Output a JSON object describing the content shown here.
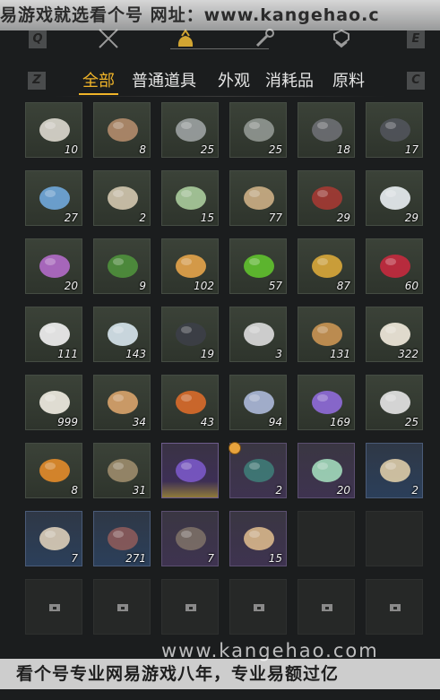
{
  "watermark": {
    "top_text": "易游戏就选看个号   网址：www.kangehao.c",
    "mid_text": "www.kangehao.com",
    "bottom_text": "看个号专业网易游戏八年，专业易额过亿"
  },
  "keys": {
    "left_top": "Q",
    "right_top": "E",
    "left_tab": "Z",
    "right_tab": "C"
  },
  "top_icons": [
    "crossed-swords-icon",
    "bag-icon",
    "wrench-icon",
    "armor-icon"
  ],
  "tabs": [
    {
      "label": "全部",
      "active": true
    },
    {
      "label": "普通道具",
      "active": false
    },
    {
      "label": "外观",
      "active": false
    },
    {
      "label": "消耗品",
      "active": false
    },
    {
      "label": "原料",
      "active": false
    }
  ],
  "items": [
    {
      "name": "coral",
      "count": "10"
    },
    {
      "name": "pufferfish",
      "count": "8"
    },
    {
      "name": "fish",
      "count": "25"
    },
    {
      "name": "catfish",
      "count": "25"
    },
    {
      "name": "iron-ore",
      "count": "18"
    },
    {
      "name": "dark-ore",
      "count": "17"
    },
    {
      "name": "blue-crystal",
      "count": "27"
    },
    {
      "name": "bone-spine",
      "count": "2"
    },
    {
      "name": "green-egg",
      "count": "15"
    },
    {
      "name": "rice-sacks",
      "count": "77"
    },
    {
      "name": "red-berry-herb",
      "count": "29"
    },
    {
      "name": "white-flower",
      "count": "29"
    },
    {
      "name": "purple-flower",
      "count": "20"
    },
    {
      "name": "green-herb",
      "count": "9"
    },
    {
      "name": "sparkler",
      "count": "102"
    },
    {
      "name": "jade-orb",
      "count": "57"
    },
    {
      "name": "gold-ore",
      "count": "87"
    },
    {
      "name": "red-crystal",
      "count": "60"
    },
    {
      "name": "white-lily",
      "count": "111"
    },
    {
      "name": "ice-block",
      "count": "143"
    },
    {
      "name": "dark-feather",
      "count": "19"
    },
    {
      "name": "white-fur",
      "count": "3"
    },
    {
      "name": "wood-bundle",
      "count": "131"
    },
    {
      "name": "rice-bowl",
      "count": "322"
    },
    {
      "name": "milk-bowl",
      "count": "999"
    },
    {
      "name": "tofu-cubes",
      "count": "34"
    },
    {
      "name": "roast-meat",
      "count": "43"
    },
    {
      "name": "blue-spider-lily",
      "count": "94"
    },
    {
      "name": "lavender",
      "count": "169"
    },
    {
      "name": "white-peony",
      "count": "25"
    },
    {
      "name": "orange-fruit-herb",
      "count": "8"
    },
    {
      "name": "root-herb",
      "count": "31"
    },
    {
      "name": "amethyst",
      "count": ""
    },
    {
      "name": "gift-box-dark",
      "count": "2"
    },
    {
      "name": "gift-box-green",
      "count": "20"
    },
    {
      "name": "scroll",
      "count": "2"
    },
    {
      "name": "clay-jar",
      "count": "7"
    },
    {
      "name": "book-chest",
      "count": "271"
    },
    {
      "name": "horn-dark",
      "count": "7"
    },
    {
      "name": "horn-light",
      "count": "15"
    }
  ],
  "colors": {
    "accent": "#f0b429",
    "slot_green": "#343b32",
    "slot_purple": "#3d2f55"
  }
}
